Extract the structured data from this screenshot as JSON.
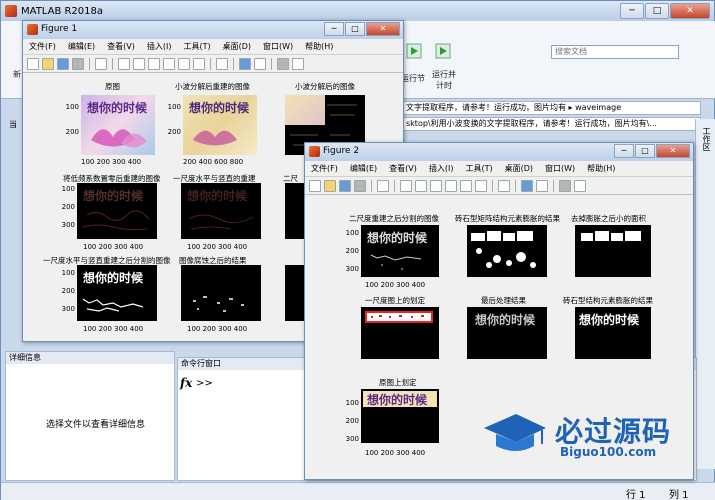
{
  "app": {
    "title": "MATLAB R2018a",
    "search_placeholder": "搜索文档",
    "ribbon_labels": [
      "运行节",
      "运行并\n计时"
    ],
    "path_line1": "文字提取程序，请参考！运行成功，图片均有 ▸ waveimage",
    "path_line2": "sktop\\利用小波变换的文字提取程序，请参考！运行成功，图片均有\\...",
    "right_panel_label": "工作区",
    "detail_panel_title": "详细信息",
    "detail_panel_text": "选择文件以查看详细信息",
    "command_window_title": "命令行窗口",
    "prompt": ">>",
    "status_row_label": "行 1",
    "status_col_label": "列 1",
    "side_labels": [
      "新",
      "当"
    ]
  },
  "figure1": {
    "title": "Figure 1",
    "menus": [
      "文件(F)",
      "编辑(E)",
      "查看(V)",
      "插入(I)",
      "工具(T)",
      "桌面(D)",
      "窗口(W)",
      "帮助(H)"
    ],
    "subplots": [
      {
        "title": "原图",
        "yticks": [
          "100",
          "200"
        ],
        "xticks": [
          "100 200 300 400"
        ]
      },
      {
        "title": "小波分解后重建的图像",
        "yticks": [
          "100",
          "200"
        ],
        "xticks": [
          "200 400 600 800"
        ]
      },
      {
        "title": "小波分解后的图像",
        "yticks": [
          "100",
          "200"
        ],
        "xticks": [
          ""
        ]
      },
      {
        "title": "将低频系数置零后重建的图像",
        "yticks": [
          "100",
          "200",
          "300"
        ],
        "xticks": [
          "100 200 300 400"
        ]
      },
      {
        "title": "一尺度水平与竖直的重建",
        "yticks": [],
        "xticks": [
          "100 200 300 400"
        ]
      },
      {
        "title": "二尺",
        "yticks": [],
        "xticks": [
          ""
        ]
      },
      {
        "title": "一尺度水平与竖直重建之后分割的图像",
        "yticks": [
          "100",
          "200",
          "300"
        ],
        "xticks": [
          "100 200 300 400"
        ]
      },
      {
        "title": "图像腐蚀之后的结果",
        "yticks": [],
        "xticks": [
          "100 200 300 400"
        ]
      },
      {
        "title": "",
        "yticks": [],
        "xticks": [
          ""
        ]
      }
    ],
    "image_text": "想你的时候"
  },
  "figure2": {
    "title": "Figure 2",
    "menus": [
      "文件(F)",
      "编辑(E)",
      "查看(V)",
      "插入(I)",
      "工具(T)",
      "桌面(D)",
      "窗口(W)",
      "帮助(H)"
    ],
    "subplots": [
      {
        "title": "二尺度重建之后分割的图像",
        "yticks": [
          "100",
          "200",
          "300"
        ],
        "xticks": [
          "100 200 300 400"
        ]
      },
      {
        "title": "砖石型矩阵结构元素膨胀的结果",
        "yticks": [],
        "xticks": [
          ""
        ]
      },
      {
        "title": "去掉膨胀之后小的面积",
        "yticks": [],
        "xticks": [
          ""
        ]
      },
      {
        "title": "一尺度图上的划定",
        "yticks": [],
        "xticks": [
          ""
        ]
      },
      {
        "title": "最后处理结果",
        "yticks": [],
        "xticks": [
          ""
        ]
      },
      {
        "title": "砖石型结构元素膨胀的结果",
        "yticks": [],
        "xticks": [
          ""
        ]
      },
      {
        "title": "原图上划定",
        "yticks": [
          "100",
          "200",
          "300"
        ],
        "xticks": [
          "100 200 300 400"
        ]
      }
    ],
    "image_text": "想你的时候"
  },
  "watermark": {
    "text": "必过源码",
    "sub": "Biguo100.com"
  },
  "colors": {
    "accent": "#1e63b5",
    "image_bg": "#000000"
  }
}
